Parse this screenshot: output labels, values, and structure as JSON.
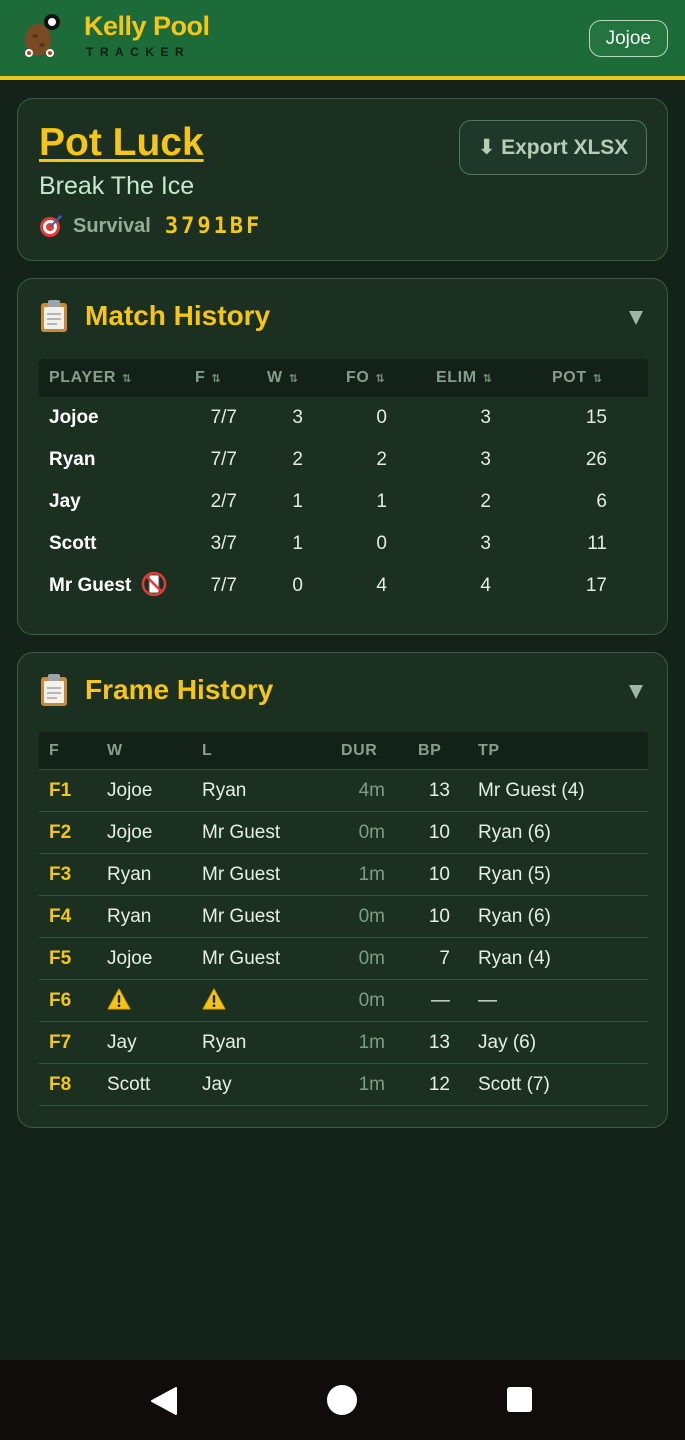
{
  "header": {
    "brand_title": "Kelly Pool",
    "brand_sub": "TRACKER",
    "user": "Jojoe"
  },
  "game": {
    "title": "Pot Luck",
    "subtitle": "Break The Ice",
    "mode": "Survival",
    "code": "3791BF",
    "export_label": "⬇ Export XLSX"
  },
  "match_history": {
    "title": "Match History",
    "columns": [
      "PLAYER",
      "F",
      "W",
      "FO",
      "ELIM",
      "POT"
    ],
    "rows": [
      {
        "player": "Jojoe",
        "f": "7/7",
        "w": "3",
        "fo": "0",
        "elim": "3",
        "pot": "15",
        "no_show": false
      },
      {
        "player": "Ryan",
        "f": "7/7",
        "w": "2",
        "fo": "2",
        "elim": "3",
        "pot": "26",
        "no_show": false
      },
      {
        "player": "Jay",
        "f": "2/7",
        "w": "1",
        "fo": "1",
        "elim": "2",
        "pot": "6",
        "no_show": false
      },
      {
        "player": "Scott",
        "f": "3/7",
        "w": "1",
        "fo": "0",
        "elim": "3",
        "pot": "11",
        "no_show": false
      },
      {
        "player": "Mr Guest",
        "f": "7/7",
        "w": "0",
        "fo": "4",
        "elim": "4",
        "pot": "17",
        "no_show": true
      }
    ]
  },
  "frame_history": {
    "title": "Frame History",
    "columns": [
      "F",
      "W",
      "L",
      "DUR",
      "BP",
      "TP"
    ],
    "rows": [
      {
        "f": "F1",
        "w": "Jojoe",
        "l": "Ryan",
        "dur": "4m",
        "bp": "13",
        "tp": "Mr Guest (4)",
        "warn": false
      },
      {
        "f": "F2",
        "w": "Jojoe",
        "l": "Mr Guest",
        "dur": "0m",
        "bp": "10",
        "tp": "Ryan (6)",
        "warn": false
      },
      {
        "f": "F3",
        "w": "Ryan",
        "l": "Mr Guest",
        "dur": "1m",
        "bp": "10",
        "tp": "Ryan (5)",
        "warn": false
      },
      {
        "f": "F4",
        "w": "Ryan",
        "l": "Mr Guest",
        "dur": "0m",
        "bp": "10",
        "tp": "Ryan (6)",
        "warn": false
      },
      {
        "f": "F5",
        "w": "Jojoe",
        "l": "Mr Guest",
        "dur": "0m",
        "bp": "7",
        "tp": "Ryan (4)",
        "warn": false
      },
      {
        "f": "F6",
        "w": "",
        "l": "",
        "dur": "0m",
        "bp": "—",
        "tp": "—",
        "warn": true
      },
      {
        "f": "F7",
        "w": "Jay",
        "l": "Ryan",
        "dur": "1m",
        "bp": "13",
        "tp": "Jay (6)",
        "warn": false
      },
      {
        "f": "F8",
        "w": "Scott",
        "l": "Jay",
        "dur": "1m",
        "bp": "12",
        "tp": "Scott (7)",
        "warn": false
      }
    ]
  },
  "colors": {
    "accent": "#f5c518",
    "header_bg": "#1c6b39",
    "page_bg": "#142319",
    "card_bg": "#1c3022"
  },
  "icons": {
    "logo": "potato-pool-mascot-icon",
    "mode": "target-icon",
    "section": "clipboard-icon",
    "no_show": "no-phone-icon",
    "warning": "warning-icon"
  }
}
